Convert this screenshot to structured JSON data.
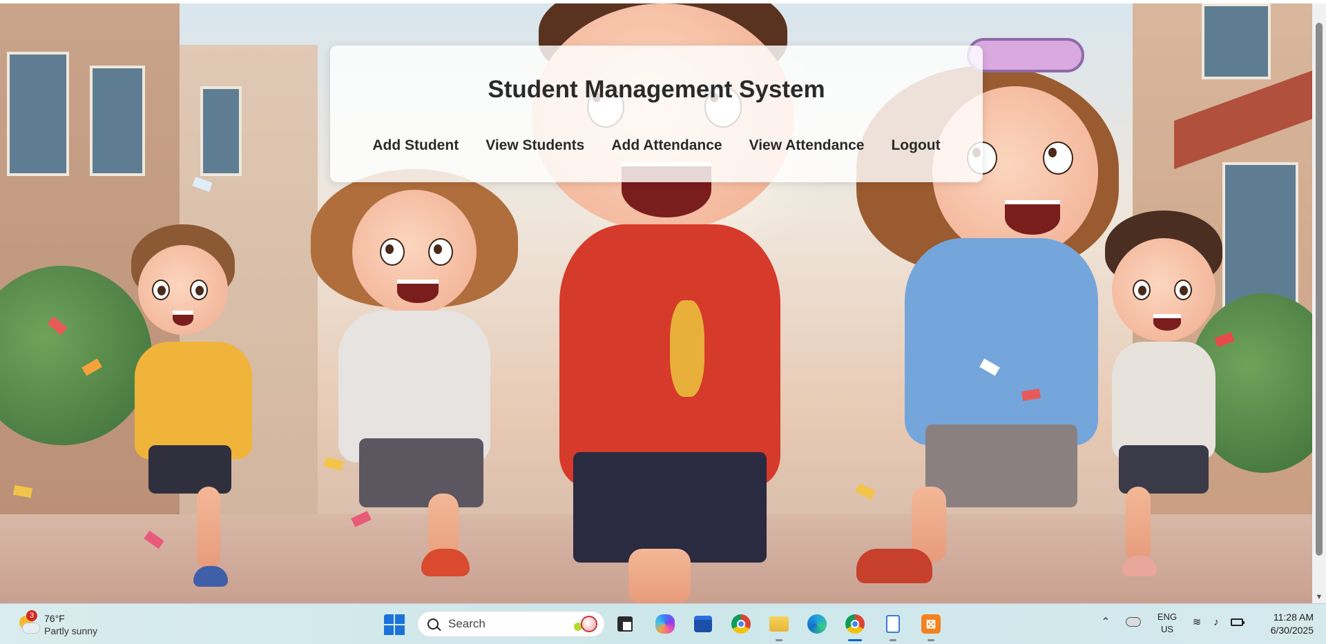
{
  "page": {
    "title": "Student Management System",
    "nav": [
      {
        "label": "Add Student"
      },
      {
        "label": "View Students"
      },
      {
        "label": "Add Attendance"
      },
      {
        "label": "View Attendance"
      },
      {
        "label": "Logout"
      }
    ]
  },
  "taskbar": {
    "weather": {
      "temp": "76°F",
      "description": "Partly sunny",
      "badge": "3",
      "icon": "partly-sunny-icon"
    },
    "search": {
      "label": "Search"
    },
    "apps": [
      {
        "name": "start",
        "icon": "windows-start-icon"
      },
      {
        "name": "task-view",
        "icon": "task-view-icon"
      },
      {
        "name": "copilot",
        "icon": "copilot-icon"
      },
      {
        "name": "microsoft-store",
        "icon": "store-icon"
      },
      {
        "name": "chrome",
        "icon": "chrome-icon"
      },
      {
        "name": "file-explorer",
        "icon": "folder-icon"
      },
      {
        "name": "edge",
        "icon": "edge-icon"
      },
      {
        "name": "chrome-active",
        "icon": "chrome-icon"
      },
      {
        "name": "notes",
        "icon": "notes-icon"
      },
      {
        "name": "xampp",
        "icon": "xampp-icon",
        "glyph": "⊠"
      }
    ],
    "tray": {
      "language": "ENG",
      "region": "US",
      "time": "11:28 AM",
      "date": "6/30/2025"
    }
  },
  "colors": {
    "accent": "#0a64c8",
    "title_text": "#2a2a2a",
    "card_bg": "rgba(255,255,255,0.82)"
  }
}
